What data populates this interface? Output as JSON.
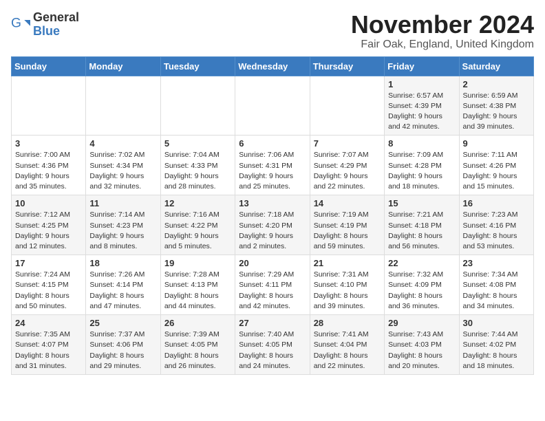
{
  "header": {
    "logo_line1": "General",
    "logo_line2": "Blue",
    "month_title": "November 2024",
    "subtitle": "Fair Oak, England, United Kingdom"
  },
  "days_of_week": [
    "Sunday",
    "Monday",
    "Tuesday",
    "Wednesday",
    "Thursday",
    "Friday",
    "Saturday"
  ],
  "weeks": [
    [
      {
        "day": "",
        "info": ""
      },
      {
        "day": "",
        "info": ""
      },
      {
        "day": "",
        "info": ""
      },
      {
        "day": "",
        "info": ""
      },
      {
        "day": "",
        "info": ""
      },
      {
        "day": "1",
        "info": "Sunrise: 6:57 AM\nSunset: 4:39 PM\nDaylight: 9 hours and 42 minutes."
      },
      {
        "day": "2",
        "info": "Sunrise: 6:59 AM\nSunset: 4:38 PM\nDaylight: 9 hours and 39 minutes."
      }
    ],
    [
      {
        "day": "3",
        "info": "Sunrise: 7:00 AM\nSunset: 4:36 PM\nDaylight: 9 hours and 35 minutes."
      },
      {
        "day": "4",
        "info": "Sunrise: 7:02 AM\nSunset: 4:34 PM\nDaylight: 9 hours and 32 minutes."
      },
      {
        "day": "5",
        "info": "Sunrise: 7:04 AM\nSunset: 4:33 PM\nDaylight: 9 hours and 28 minutes."
      },
      {
        "day": "6",
        "info": "Sunrise: 7:06 AM\nSunset: 4:31 PM\nDaylight: 9 hours and 25 minutes."
      },
      {
        "day": "7",
        "info": "Sunrise: 7:07 AM\nSunset: 4:29 PM\nDaylight: 9 hours and 22 minutes."
      },
      {
        "day": "8",
        "info": "Sunrise: 7:09 AM\nSunset: 4:28 PM\nDaylight: 9 hours and 18 minutes."
      },
      {
        "day": "9",
        "info": "Sunrise: 7:11 AM\nSunset: 4:26 PM\nDaylight: 9 hours and 15 minutes."
      }
    ],
    [
      {
        "day": "10",
        "info": "Sunrise: 7:12 AM\nSunset: 4:25 PM\nDaylight: 9 hours and 12 minutes."
      },
      {
        "day": "11",
        "info": "Sunrise: 7:14 AM\nSunset: 4:23 PM\nDaylight: 9 hours and 8 minutes."
      },
      {
        "day": "12",
        "info": "Sunrise: 7:16 AM\nSunset: 4:22 PM\nDaylight: 9 hours and 5 minutes."
      },
      {
        "day": "13",
        "info": "Sunrise: 7:18 AM\nSunset: 4:20 PM\nDaylight: 9 hours and 2 minutes."
      },
      {
        "day": "14",
        "info": "Sunrise: 7:19 AM\nSunset: 4:19 PM\nDaylight: 8 hours and 59 minutes."
      },
      {
        "day": "15",
        "info": "Sunrise: 7:21 AM\nSunset: 4:18 PM\nDaylight: 8 hours and 56 minutes."
      },
      {
        "day": "16",
        "info": "Sunrise: 7:23 AM\nSunset: 4:16 PM\nDaylight: 8 hours and 53 minutes."
      }
    ],
    [
      {
        "day": "17",
        "info": "Sunrise: 7:24 AM\nSunset: 4:15 PM\nDaylight: 8 hours and 50 minutes."
      },
      {
        "day": "18",
        "info": "Sunrise: 7:26 AM\nSunset: 4:14 PM\nDaylight: 8 hours and 47 minutes."
      },
      {
        "day": "19",
        "info": "Sunrise: 7:28 AM\nSunset: 4:13 PM\nDaylight: 8 hours and 44 minutes."
      },
      {
        "day": "20",
        "info": "Sunrise: 7:29 AM\nSunset: 4:11 PM\nDaylight: 8 hours and 42 minutes."
      },
      {
        "day": "21",
        "info": "Sunrise: 7:31 AM\nSunset: 4:10 PM\nDaylight: 8 hours and 39 minutes."
      },
      {
        "day": "22",
        "info": "Sunrise: 7:32 AM\nSunset: 4:09 PM\nDaylight: 8 hours and 36 minutes."
      },
      {
        "day": "23",
        "info": "Sunrise: 7:34 AM\nSunset: 4:08 PM\nDaylight: 8 hours and 34 minutes."
      }
    ],
    [
      {
        "day": "24",
        "info": "Sunrise: 7:35 AM\nSunset: 4:07 PM\nDaylight: 8 hours and 31 minutes."
      },
      {
        "day": "25",
        "info": "Sunrise: 7:37 AM\nSunset: 4:06 PM\nDaylight: 8 hours and 29 minutes."
      },
      {
        "day": "26",
        "info": "Sunrise: 7:39 AM\nSunset: 4:05 PM\nDaylight: 8 hours and 26 minutes."
      },
      {
        "day": "27",
        "info": "Sunrise: 7:40 AM\nSunset: 4:05 PM\nDaylight: 8 hours and 24 minutes."
      },
      {
        "day": "28",
        "info": "Sunrise: 7:41 AM\nSunset: 4:04 PM\nDaylight: 8 hours and 22 minutes."
      },
      {
        "day": "29",
        "info": "Sunrise: 7:43 AM\nSunset: 4:03 PM\nDaylight: 8 hours and 20 minutes."
      },
      {
        "day": "30",
        "info": "Sunrise: 7:44 AM\nSunset: 4:02 PM\nDaylight: 8 hours and 18 minutes."
      }
    ]
  ]
}
